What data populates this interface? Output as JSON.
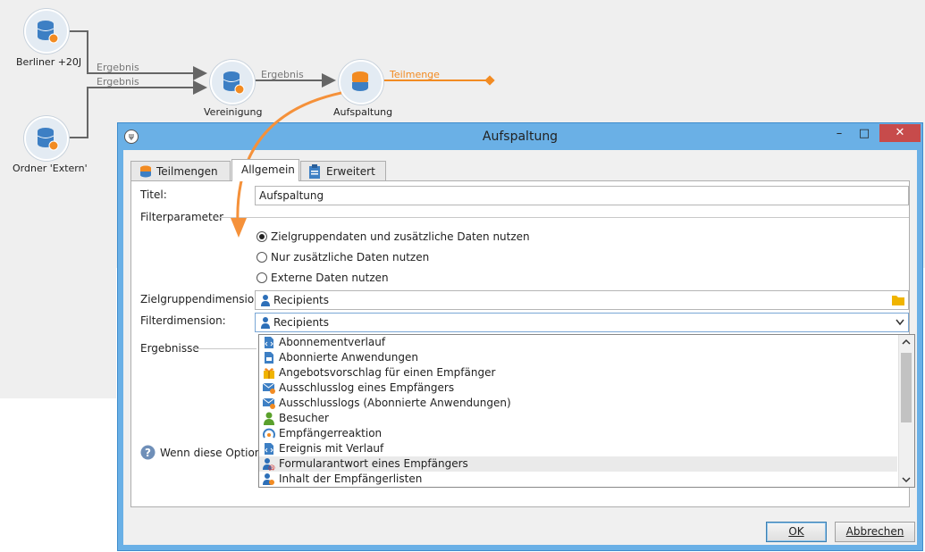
{
  "workflow": {
    "nodes": [
      {
        "id": "berliner",
        "label": "Berliner +20J"
      },
      {
        "id": "extern",
        "label": "Ordner 'Extern'"
      },
      {
        "id": "vereinigung",
        "label": "Vereinigung"
      },
      {
        "id": "aufspaltung",
        "label": "Aufspaltung"
      }
    ],
    "links": {
      "ergebnis1": "Ergebnis",
      "ergebnis2": "Ergebnis",
      "ergebnis3": "Ergebnis",
      "teilmenge": "Teilmenge"
    },
    "accent_color": "#f28b22"
  },
  "dialog": {
    "title": "Aufspaltung",
    "app_icon": "ψ",
    "controls": {
      "minimize": "–",
      "maximize": "□",
      "close": "✕"
    },
    "tabs": [
      {
        "label": "Teilmengen",
        "icon": "database-icon",
        "active": false
      },
      {
        "label": "Allgemein",
        "active": true
      },
      {
        "label": "Erweitert",
        "icon": "clipboard-icon",
        "active": false
      }
    ],
    "form": {
      "title_label": "Titel:",
      "title_value": "Aufspaltung",
      "filter_section": "Filterparameter",
      "radios": [
        {
          "label": "Zielgruppendaten und zusätzliche Daten nutzen",
          "checked": true
        },
        {
          "label": "Nur zusätzliche Daten nutzen",
          "checked": false
        },
        {
          "label": "Externe Daten nutzen",
          "checked": false
        }
      ],
      "target_dim_label": "Zielgruppendimension:",
      "target_dim_value": "Recipients",
      "filter_dim_label": "Filterdimension:",
      "filter_dim_value": "Recipients",
      "results_section": "Ergebnisse",
      "help_text": "Wenn diese Option a"
    },
    "dropdown": {
      "items": [
        {
          "label": "Abonnementverlauf",
          "icon": "document-history-icon"
        },
        {
          "label": "Abonnierte Anwendungen",
          "icon": "document-app-icon"
        },
        {
          "label": "Angebotsvorschlag für einen Empfänger",
          "icon": "gift-icon"
        },
        {
          "label": "Ausschlusslog eines Empfängers",
          "icon": "mail-exclusion-icon"
        },
        {
          "label": "Ausschlusslogs (Abonnierte Anwendungen)",
          "icon": "mail-exclusion-icon"
        },
        {
          "label": "Besucher",
          "icon": "visitor-icon"
        },
        {
          "label": "Empfängerreaktion",
          "icon": "reaction-icon"
        },
        {
          "label": "Ereignis mit Verlauf",
          "icon": "document-event-icon"
        },
        {
          "label": "Formularantwort eines Empfängers",
          "icon": "form-response-icon",
          "hover": true
        },
        {
          "label": "Inhalt der Empfängerlisten",
          "icon": "list-content-icon"
        }
      ]
    },
    "buttons": {
      "ok": "OK",
      "cancel": "Abbrechen"
    }
  }
}
